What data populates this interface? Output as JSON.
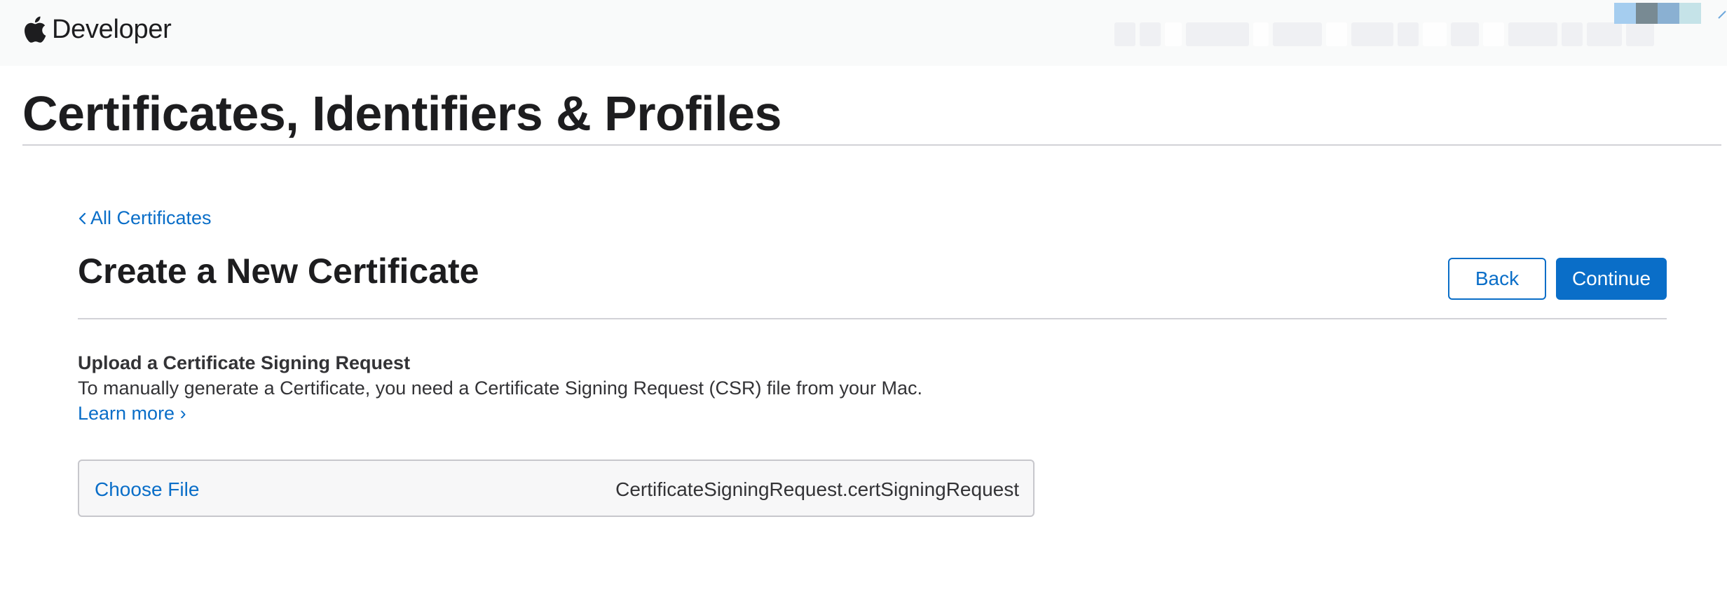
{
  "header": {
    "brand_name": "Developer",
    "brand_icon": "apple-logo-icon",
    "obscured_account_colors": [
      "#a5cdef",
      "#788a93",
      "#8ab0d2",
      "#c5e3e8"
    ]
  },
  "page": {
    "title": "Certificates, Identifiers & Profiles"
  },
  "breadcrumb": {
    "back_label": "All Certificates",
    "back_icon": "chevron-left-icon"
  },
  "section": {
    "title": "Create a New Certificate",
    "back_button": "Back",
    "continue_button": "Continue"
  },
  "csr": {
    "heading": "Upload a Certificate Signing Request",
    "description": "To manually generate a Certificate, you need a Certificate Signing Request (CSR) file from your Mac.",
    "learn_more": "Learn more ›",
    "choose_file": "Choose File",
    "file_name": "CertificateSigningRequest.certSigningRequest"
  },
  "colors": {
    "accent": "#0a6ec8",
    "text": "#1d1d1f",
    "divider": "#d2d2d7",
    "topbar": "#f9fafa"
  }
}
